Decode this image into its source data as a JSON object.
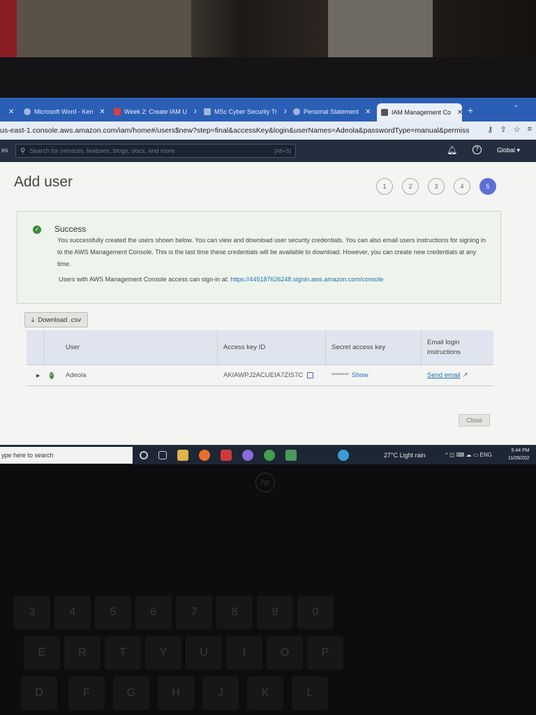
{
  "browser": {
    "tabs": [
      {
        "label": "Microsoft Word - Ken",
        "active": false
      },
      {
        "label": "Week 2: Create IAM U",
        "active": false
      },
      {
        "label": "MSc Cyber Security Tr",
        "active": false
      },
      {
        "label": "Personal Statement",
        "active": false
      },
      {
        "label": "IAM Management Co",
        "active": true
      }
    ],
    "url": "us-east-1.console.aws.amazon.com/iam/home#/users$new?step=final&accessKey&login&userNames=Adeola&passwordType=manual&permissio..."
  },
  "aws_bar": {
    "left_fragment": "es",
    "search_placeholder": "Search for services, features, blogs, docs, and more",
    "search_shortcut": "[Alt+S]",
    "region": "Global ▾"
  },
  "page": {
    "title": "Add user",
    "steps": [
      "1",
      "2",
      "3",
      "4",
      "5"
    ],
    "current_step": 5
  },
  "alert": {
    "title": "Success",
    "message": "You successfully created the users shown below. You can view and download user security credentials. You can also email users instructions for signing in to the AWS Management Console. This is the last time these credentials will be available to download. However, you can create new credentials at any time.",
    "signin_prefix": "Users with AWS Management Console access can sign-in at:",
    "signin_url": "https://445187626248.signin.aws.amazon.com/console"
  },
  "download_button": "Download .csv",
  "table": {
    "headers": [
      "User",
      "Access key ID",
      "Secret access key",
      "Email login instructions"
    ],
    "rows": [
      {
        "user": "Adeola",
        "access_key_id": "AKIAWPJ2ACUEIA7ZIS7C",
        "secret_mask": "********",
        "secret_action": "Show",
        "email_action": "Send email"
      }
    ]
  },
  "close_button": "Close",
  "taskbar": {
    "search": "ype here to search",
    "weather": "27°C  Light rain",
    "tray": "ENG",
    "time": "5:44 PM",
    "date": "11/09/202"
  },
  "keyboard": {
    "brand": "hp",
    "keys": [
      "3",
      "4",
      "5",
      "6",
      "7",
      "8",
      "9",
      "0",
      "E",
      "R",
      "T",
      "Y",
      "U",
      "I",
      "O",
      "P",
      "D",
      "F",
      "G",
      "H",
      "J",
      "K",
      "L"
    ]
  },
  "colors": {
    "tab_strip": "#2b5fb5",
    "aws_bar": "#232f3e",
    "success_bg": "#eef4ec",
    "step_active": "#5b6fd6",
    "link": "#1f6fb3"
  }
}
